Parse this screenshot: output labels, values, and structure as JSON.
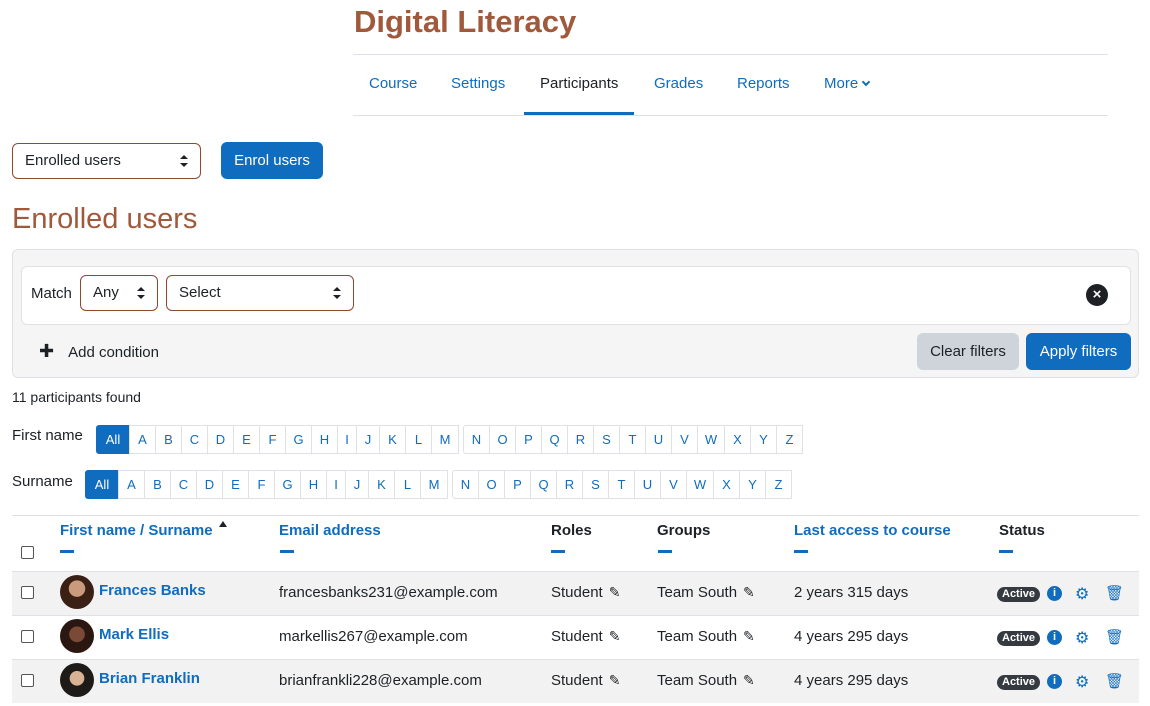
{
  "course": {
    "title": "Digital Literacy"
  },
  "nav": {
    "tabs": [
      "Course",
      "Settings",
      "Participants",
      "Grades",
      "Reports",
      "More"
    ],
    "active": "Participants"
  },
  "enrol": {
    "select_value": "Enrolled users",
    "button_label": "Enrol users"
  },
  "page": {
    "heading": "Enrolled users"
  },
  "filters": {
    "match_label": "Match",
    "match_value": "Any",
    "type_value": "Select",
    "add_condition": "Add condition",
    "clear_label": "Clear filters",
    "apply_label": "Apply filters"
  },
  "summary": {
    "found": "11 participants found"
  },
  "initials": {
    "first_label": "First name",
    "surname_label": "Surname",
    "all_label": "All",
    "letters_a_m": [
      "A",
      "B",
      "C",
      "D",
      "E",
      "F",
      "G",
      "H",
      "I",
      "J",
      "K",
      "L",
      "M"
    ],
    "letters_n_z": [
      "N",
      "O",
      "P",
      "Q",
      "R",
      "S",
      "T",
      "U",
      "V",
      "W",
      "X",
      "Y",
      "Z"
    ]
  },
  "table": {
    "headers": {
      "name_first": "First name",
      "name_sep": " / ",
      "name_last": "Surname",
      "email": "Email address",
      "roles": "Roles",
      "groups": "Groups",
      "last_access": "Last access to course",
      "status": "Status"
    },
    "rows": [
      {
        "name": "Frances Banks",
        "email": "francesbanks231@example.com",
        "role": "Student",
        "group": "Team South",
        "last_access": "2 years 315 days",
        "status": "Active"
      },
      {
        "name": "Mark Ellis",
        "email": "markellis267@example.com",
        "role": "Student",
        "group": "Team South",
        "last_access": "4 years 295 days",
        "status": "Active"
      },
      {
        "name": "Brian Franklin",
        "email": "brianfrankli228@example.com",
        "role": "Student",
        "group": "Team South",
        "last_access": "4 years 295 days",
        "status": "Active"
      }
    ]
  },
  "icons": {
    "pencil": "pencil-icon",
    "info": "info-icon",
    "gear": "gear-icon",
    "trash": "trash-icon",
    "close": "close-icon",
    "plus": "plus-icon"
  },
  "colors": {
    "brand": "#0f6cbf",
    "heading": "#a0593b",
    "badge": "#343a40"
  }
}
